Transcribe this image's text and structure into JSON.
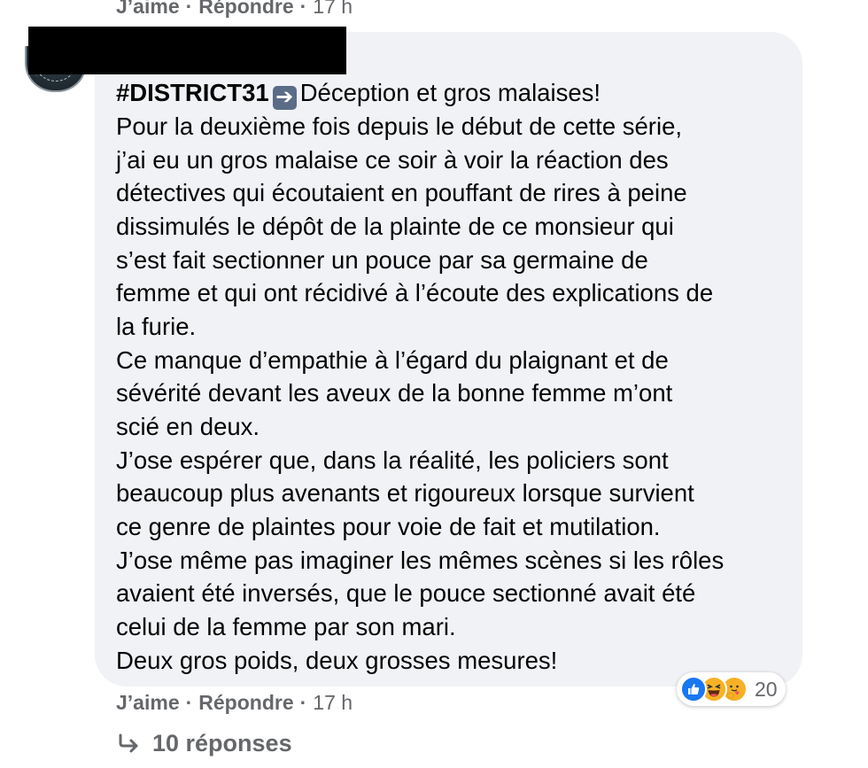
{
  "previous_comment": {
    "like_label": "J’aime",
    "separator": "·",
    "reply_label": "Répondre",
    "separator2": "·",
    "time": "17 h"
  },
  "comment": {
    "hashtag": "#DISTRICT31",
    "arrow_icon": "right-arrow-emoji-icon",
    "headline": "Déception et gros malaises!",
    "lines": [
      "Pour la deuxième fois depuis le début de cette série,",
      "j’ai eu un gros malaise ce soir à voir la réaction des",
      "détectives qui écoutaient en pouffant de rires à peine",
      "dissimulés le dépôt de la plainte de ce monsieur qui",
      "s’est fait sectionner un pouce par sa germaine de",
      "femme et qui ont récidivé à l’écoute des explications de",
      "la furie.",
      "Ce manque d’empathie à l’égard du plaignant et de",
      "sévérité devant les aveux de la bonne femme m’ont",
      "scié en deux.",
      "J’ose espérer que, dans la réalité, les policiers sont",
      "beaucoup plus avenants et rigoureux lorsque survient",
      "ce genre de plaintes pour voie de fait et mutilation.",
      "J’ose même pas imaginer les mêmes scènes si les rôles",
      "avaient été inversés, que le pouce sectionné avait été",
      "celui de la femme par son mari.",
      "Deux gros poids, deux grosses mesures!"
    ]
  },
  "reactions": {
    "icons": [
      "like-icon",
      "haha-icon",
      "care-icon"
    ],
    "count": "20",
    "colors": {
      "like": "#1877f2",
      "haha": "#f7b125",
      "care": "#f7b125"
    }
  },
  "actions": {
    "like_label": "J’aime",
    "separator": "·",
    "reply_label": "Répondre",
    "separator2": "·",
    "time": "17 h"
  },
  "replies": {
    "icon": "reply-arrow-icon",
    "label": "10 réponses"
  },
  "colors": {
    "bubble_bg": "#f0f2f5",
    "text": "#050505",
    "secondary_text": "#65676b"
  }
}
